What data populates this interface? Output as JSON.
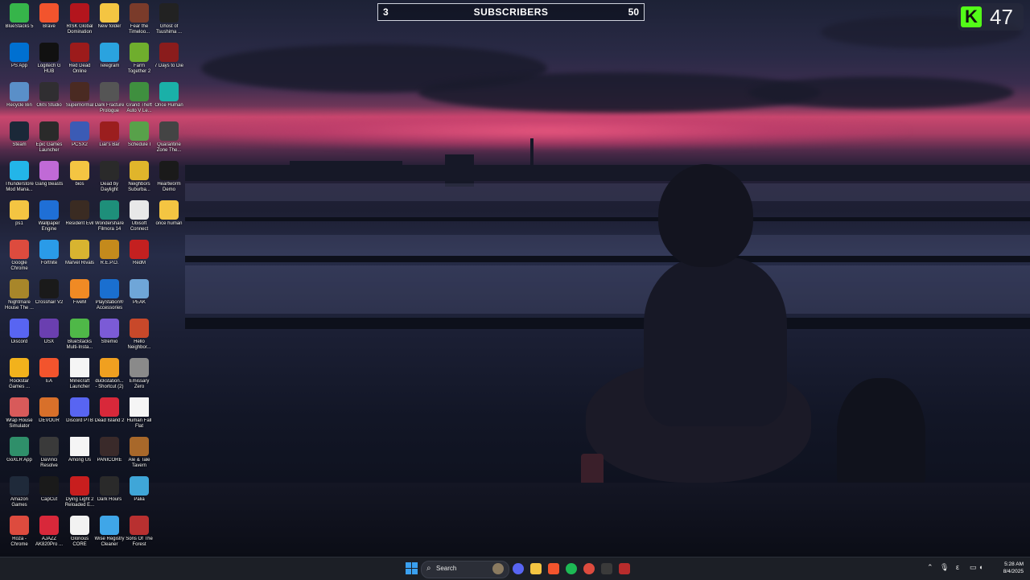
{
  "overlays": {
    "subscribers": {
      "current": "3",
      "title": "SUBSCRIBERS",
      "goal": "50"
    },
    "kick_badge": {
      "logo": "K",
      "count": "47"
    }
  },
  "desktop_icons": [
    {
      "label": "BlueStacks 5",
      "icon": "bluestacks-icon",
      "color": "#36b54a"
    },
    {
      "label": "Brave",
      "icon": "brave-icon",
      "color": "#f2542d"
    },
    {
      "label": "RISK Global Domination",
      "icon": "risk-icon",
      "color": "#b3151d"
    },
    {
      "label": "New folder",
      "icon": "folder-icon",
      "color": "#f4c542"
    },
    {
      "label": "Fear the Timeloo...",
      "icon": "game-icon",
      "color": "#7a3b2a"
    },
    {
      "label": "Ghost of Tsushima ...",
      "icon": "game-icon",
      "color": "#222222"
    },
    {
      "label": "PS App",
      "icon": "playstation-icon",
      "color": "#0070d1"
    },
    {
      "label": "Logitech G HUB",
      "icon": "logitech-icon",
      "color": "#111111"
    },
    {
      "label": "Red Dead Online",
      "icon": "game-icon",
      "color": "#9c1b1b"
    },
    {
      "label": "Telegram",
      "icon": "telegram-icon",
      "color": "#2aa3df"
    },
    {
      "label": "Farm Together 2",
      "icon": "game-icon",
      "color": "#6fae2d"
    },
    {
      "label": "7 Days to Die",
      "icon": "game-icon",
      "color": "#8a1c1c"
    },
    {
      "label": "Recycle Bin",
      "icon": "recycle-bin-icon",
      "color": "#5a8fc8"
    },
    {
      "label": "OBS Studio",
      "icon": "obs-icon",
      "color": "#302e31"
    },
    {
      "label": "Supernormal",
      "icon": "game-icon",
      "color": "#4a2a22"
    },
    {
      "label": "Dark Fracture Prologue",
      "icon": "game-icon",
      "color": "#555555"
    },
    {
      "label": "Grand Theft Auto V Le...",
      "icon": "gta-icon",
      "color": "#3f8f3f"
    },
    {
      "label": "Once Human",
      "icon": "game-icon",
      "color": "#1ab0a8"
    },
    {
      "label": "Steam",
      "icon": "steam-icon",
      "color": "#1b2838"
    },
    {
      "label": "Epic Games Launcher",
      "icon": "epic-icon",
      "color": "#2a2a2a"
    },
    {
      "label": "PCSX2",
      "icon": "pcsx2-icon",
      "color": "#3b5bb5"
    },
    {
      "label": "Liar's Bar",
      "icon": "game-icon",
      "color": "#9b1e1e"
    },
    {
      "label": "Schedule I",
      "icon": "game-icon",
      "color": "#58a14a"
    },
    {
      "label": "Quarantine Zone The...",
      "icon": "game-icon",
      "color": "#444444"
    },
    {
      "label": "Thunderstore Mod Mana...",
      "icon": "thunderstore-icon",
      "color": "#23b5e8"
    },
    {
      "label": "Gang Beasts",
      "icon": "game-icon",
      "color": "#c06ad6"
    },
    {
      "label": "bios",
      "icon": "folder-icon",
      "color": "#f4c542"
    },
    {
      "label": "Dead by Daylight",
      "icon": "game-icon",
      "color": "#2a2a2a"
    },
    {
      "label": "Neighbors Suburba...",
      "icon": "game-icon",
      "color": "#e0b52b"
    },
    {
      "label": "Heartworm Demo",
      "icon": "game-icon",
      "color": "#1a1a1a"
    },
    {
      "label": "ps1",
      "icon": "folder-icon",
      "color": "#f4c542"
    },
    {
      "label": "Wallpaper Engine",
      "icon": "wallpaper-engine-icon",
      "color": "#1f6fd6"
    },
    {
      "label": "Resident Evil",
      "icon": "game-icon",
      "color": "#3a2b22"
    },
    {
      "label": "Wondershare Filmora 14",
      "icon": "filmora-icon",
      "color": "#1e8f7a"
    },
    {
      "label": "Ubisoft Connect",
      "icon": "ubisoft-icon",
      "color": "#e8e8e8"
    },
    {
      "label": "once human",
      "icon": "folder-icon",
      "color": "#f4c542"
    },
    {
      "label": "Google Chrome",
      "icon": "chrome-icon",
      "color": "#dd4b3e"
    },
    {
      "label": "Fortnite",
      "icon": "fortnite-icon",
      "color": "#2a9be8"
    },
    {
      "label": "Marvel Rivals",
      "icon": "game-icon",
      "color": "#d8b430"
    },
    {
      "label": "R.E.P.O.",
      "icon": "game-icon",
      "color": "#c48a1c"
    },
    {
      "label": "RedM",
      "icon": "redm-icon",
      "color": "#c42020"
    },
    {
      "label": "",
      "icon": "none",
      "color": "transparent"
    },
    {
      "label": "Nightmare House The ...",
      "icon": "game-icon",
      "color": "#a8862a"
    },
    {
      "label": "Crosshair V2",
      "icon": "crosshair-icon",
      "color": "#1a1a1a"
    },
    {
      "label": "FiveM",
      "icon": "fivem-icon",
      "color": "#f08a24"
    },
    {
      "label": "PlayStation® Accessories",
      "icon": "playstation-icon",
      "color": "#1a6fd0"
    },
    {
      "label": "PEAK",
      "icon": "game-icon",
      "color": "#6fa6d8"
    },
    {
      "label": "",
      "icon": "none",
      "color": "transparent"
    },
    {
      "label": "Discord",
      "icon": "discord-icon",
      "color": "#5865f2"
    },
    {
      "label": "DSX",
      "icon": "dsx-icon",
      "color": "#6a3fb0"
    },
    {
      "label": "BlueStacks Multi-Insta...",
      "icon": "bluestacks-icon",
      "color": "#4fb848"
    },
    {
      "label": "Stremio",
      "icon": "stremio-icon",
      "color": "#7b5bd6"
    },
    {
      "label": "Hello Neighbor...",
      "icon": "game-icon",
      "color": "#c8482a"
    },
    {
      "label": "",
      "icon": "none",
      "color": "transparent"
    },
    {
      "label": "Rockstar Games ...",
      "icon": "rockstar-icon",
      "color": "#f2b21c"
    },
    {
      "label": "EA",
      "icon": "ea-icon",
      "color": "#f2542d"
    },
    {
      "label": "Minecraft Launcher",
      "icon": "file-icon",
      "color": "#f5f5f5"
    },
    {
      "label": "duckstation... - Shortcut (2)",
      "icon": "duckstation-icon",
      "color": "#f0a020"
    },
    {
      "label": "Emissary Zero",
      "icon": "game-icon",
      "color": "#8a8a8a"
    },
    {
      "label": "",
      "icon": "none",
      "color": "transparent"
    },
    {
      "label": "Wrap House Simulator",
      "icon": "game-icon",
      "color": "#d85a5a"
    },
    {
      "label": "DEVOUR",
      "icon": "game-icon",
      "color": "#d8702a"
    },
    {
      "label": "Discord PTB",
      "icon": "discord-icon",
      "color": "#5865f2"
    },
    {
      "label": "Dead Island 2",
      "icon": "game-icon",
      "color": "#d8283a"
    },
    {
      "label": "Human Fall Flat",
      "icon": "file-icon",
      "color": "#f5f5f5"
    },
    {
      "label": "",
      "icon": "none",
      "color": "transparent"
    },
    {
      "label": "GoXLR App",
      "icon": "goxlr-icon",
      "color": "#2f8f6a"
    },
    {
      "label": "DaVinci Resolve",
      "icon": "davinci-icon",
      "color": "#3a3a3a"
    },
    {
      "label": "Among Us",
      "icon": "file-icon",
      "color": "#f5f5f5"
    },
    {
      "label": "PANICORE",
      "icon": "game-icon",
      "color": "#3a2a2a"
    },
    {
      "label": "Ale & Tale Tavern",
      "icon": "game-icon",
      "color": "#a8682a"
    },
    {
      "label": "",
      "icon": "none",
      "color": "transparent"
    },
    {
      "label": "Amazon Games",
      "icon": "amazon-games-icon",
      "color": "#1f2a3a"
    },
    {
      "label": "CapCut",
      "icon": "capcut-icon",
      "color": "#1a1a1a"
    },
    {
      "label": "Dying Light 2 Reloaded E...",
      "icon": "game-icon",
      "color": "#c81e1e"
    },
    {
      "label": "Dark Hours",
      "icon": "game-icon",
      "color": "#2a2a2a"
    },
    {
      "label": "Palia",
      "icon": "game-icon",
      "color": "#3fa6d8"
    },
    {
      "label": "",
      "icon": "none",
      "color": "transparent"
    },
    {
      "label": "Roza - Chrome",
      "icon": "chrome-icon",
      "color": "#dd4b3e"
    },
    {
      "label": "AJAZZ AK820Pro ...",
      "icon": "ajazz-icon",
      "color": "#d8283a"
    },
    {
      "label": "Glorious CORE",
      "icon": "glorious-icon",
      "color": "#f2f2f2"
    },
    {
      "label": "Wise Registry Cleaner",
      "icon": "wise-icon",
      "color": "#3fa6e8"
    },
    {
      "label": "Sons Of The Forest",
      "icon": "game-icon",
      "color": "#b83030"
    },
    {
      "label": "",
      "icon": "none",
      "color": "transparent"
    }
  ],
  "taskbar": {
    "search_placeholder": "Search",
    "pinned": [
      {
        "icon": "discord-icon",
        "color": "#5865f2"
      },
      {
        "icon": "file-explorer-icon",
        "color": "#f4c542"
      },
      {
        "icon": "brave-icon",
        "color": "#f2542d"
      },
      {
        "icon": "spotify-icon",
        "color": "#1db954"
      },
      {
        "icon": "chrome-icon",
        "color": "#dd4b3e"
      },
      {
        "icon": "terminal-icon",
        "color": "#3a3a3a"
      },
      {
        "icon": "obs-icon",
        "color": "#b82c2c"
      }
    ],
    "tray": {
      "time": "5:28 AM",
      "date": "8/4/2025"
    }
  }
}
